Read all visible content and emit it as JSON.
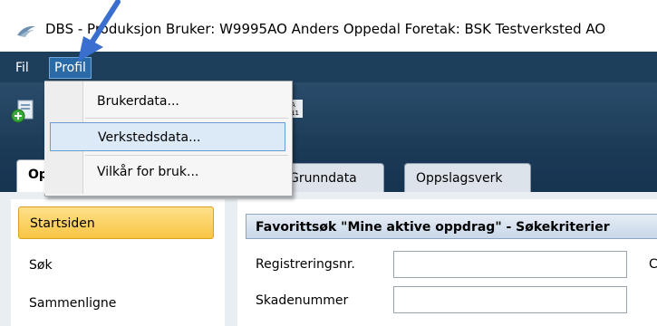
{
  "window": {
    "title": "DBS - Produksjon Bruker: W9995AO Anders Oppedal Foretak: BSK Testverksted AO"
  },
  "menubar": {
    "items": [
      {
        "label": "Fil"
      },
      {
        "label": "Profil"
      }
    ]
  },
  "profile_menu": {
    "items": [
      {
        "label": "Brukerdata..."
      },
      {
        "label": "Verkstedsdata..."
      },
      {
        "label": "Vilkår for bruk..."
      }
    ],
    "highlighted": "Verkstedsdata..."
  },
  "tabs": [
    {
      "label": "Op"
    },
    {
      "label": "Grunndata"
    },
    {
      "label": "Oppslagsverk"
    }
  ],
  "sidebar": {
    "items": [
      {
        "label": "Startsiden",
        "selected": true
      },
      {
        "label": "Søk"
      },
      {
        "label": "Sammenligne"
      }
    ]
  },
  "main": {
    "header": "Favorittsøk \"Mine aktive oppdrag\" - Søkekriterier",
    "fields": [
      {
        "label": "Registreringsnr.",
        "value": ""
      },
      {
        "label": "Skadenummer",
        "value": ""
      }
    ],
    "cut_label": "C"
  },
  "colors": {
    "menubar": "#1e3f5c",
    "toolbar": "#2a4c6b",
    "selected_nav": "#f7c544",
    "menu_highlight": "#dbeaf6",
    "arrow": "#3a6fd0"
  }
}
